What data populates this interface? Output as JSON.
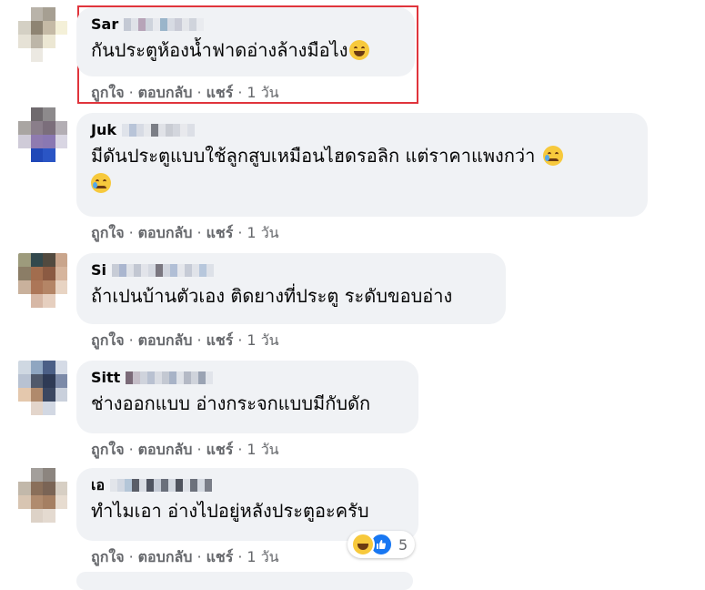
{
  "comments": [
    {
      "author_visible": "Sar",
      "text": "กันประตูห้องน้ำฟาดอ่างล้างมือไง",
      "emoji": "grinning-squinting-face",
      "actions": {
        "like": "ถูกใจ",
        "reply": "ตอบกลับ",
        "share": "แชร์",
        "time": "1 วัน"
      }
    },
    {
      "author_visible": "Juk",
      "text": "มีดันประตูแบบใช้ลูกสูบเหมือนไฮดรอลิก แต่ราคาแพงกว่า",
      "emoji": "sad-but-relieved-face",
      "actions": {
        "like": "ถูกใจ",
        "reply": "ตอบกลับ",
        "share": "แชร์",
        "time": "1 วัน"
      }
    },
    {
      "author_visible": "Si",
      "text": "ถ้าเปนบ้านตัวเอง ติดยางที่ประตู ระดับขอบอ่าง",
      "actions": {
        "like": "ถูกใจ",
        "reply": "ตอบกลับ",
        "share": "แชร์",
        "time": "1 วัน"
      }
    },
    {
      "author_visible": "Sitt",
      "text": "ช่างออกแบบ อ่างกระจกแบบมีกับดัก",
      "actions": {
        "like": "ถูกใจ",
        "reply": "ตอบกลับ",
        "share": "แชร์",
        "time": "1 วัน"
      }
    },
    {
      "author_visible": "เอ",
      "text": "ทำไมเอา อ่างไปอยู่หลังประตูอะครับ",
      "actions": {
        "like": "ถูกใจ",
        "reply": "ตอบกลับ",
        "share": "แชร์",
        "time": "1 วัน"
      },
      "reactions": {
        "types": [
          "haha-icon",
          "like-icon"
        ],
        "count": "5"
      }
    }
  ],
  "separator": "·",
  "colors": {
    "bubble": "#f0f2f5",
    "secondary_text": "#65676b",
    "highlight_border": "#e0343c",
    "like_blue": "#1877f2"
  }
}
